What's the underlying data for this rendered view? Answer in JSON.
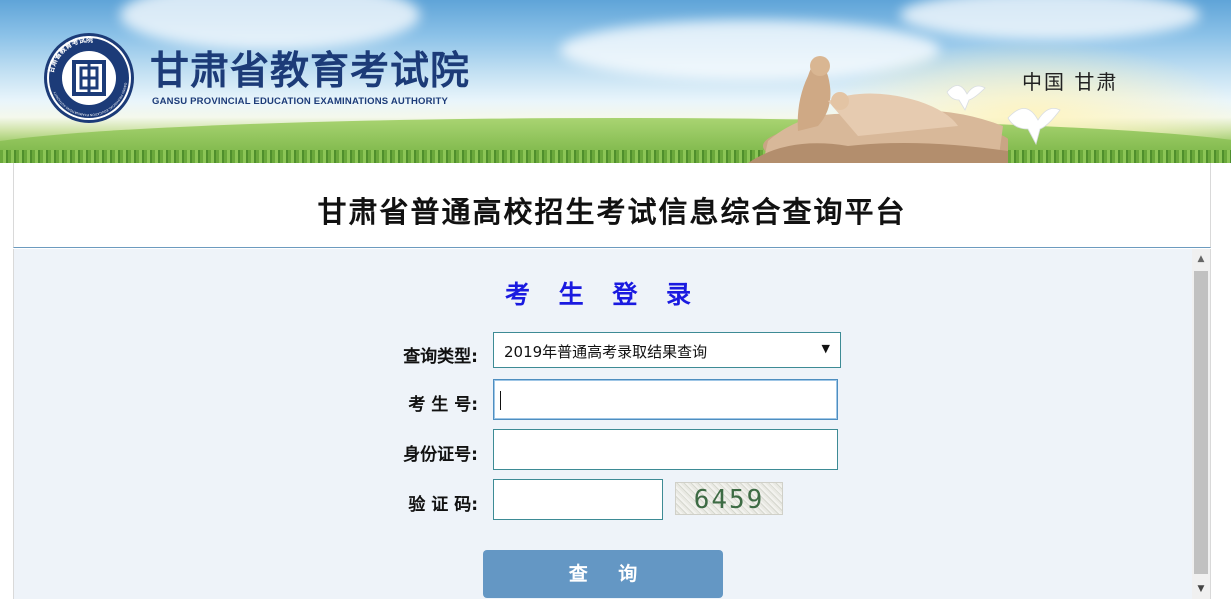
{
  "header": {
    "org_name_cn": "甘肃省教育考试院",
    "org_name_en": "GANSU PROVINCIAL EDUCATION EXAMINATIONS AUTHORITY",
    "seal_ring_text": "甘肃省教育考试院",
    "seal_ring_text_en": "GANSU PROVINCIAL EDUCATION EXAMINATIONS AUTHORITY",
    "region": "中国 甘肃"
  },
  "platform": {
    "title": "甘肃省普通高校招生考试信息综合查询平台"
  },
  "login": {
    "heading": "考 生 登 录",
    "query_type": {
      "label": "查询类型:",
      "selected": "2019年普通高考录取结果查询"
    },
    "candidate_no": {
      "label": "考 生 号:",
      "value": ""
    },
    "id_no": {
      "label": "身份证号:",
      "value": ""
    },
    "captcha": {
      "label": "验 证 码:",
      "value": "",
      "image_text": "6459"
    },
    "submit_label": "查 询"
  },
  "scrollbar": {
    "up_icon": "scroll-up-arrow-icon",
    "down_icon": "scroll-down-arrow-icon"
  },
  "colors": {
    "brand_navy": "#1c3b78",
    "heading_blue": "#1a1ae0",
    "button_blue": "#6497c4",
    "form_background": "#eef3f9",
    "field_border": "#3d8b95"
  }
}
